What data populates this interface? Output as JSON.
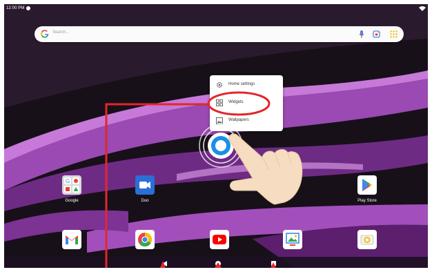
{
  "status_bar": {
    "time": "12:00 PM"
  },
  "search": {
    "placeholder": "Search..."
  },
  "context_menu": {
    "items": [
      {
        "label": "Home settings",
        "icon": "gear-icon"
      },
      {
        "label": "Widgets",
        "icon": "widgets-icon"
      },
      {
        "label": "Wallpapers",
        "icon": "wallpaper-icon"
      }
    ]
  },
  "apps": {
    "row1": [
      {
        "label": "Google",
        "icon": "google-folder-icon"
      },
      {
        "label": "Duo",
        "icon": "duo-icon"
      },
      {
        "label": "Play Store",
        "icon": "play-store-icon"
      }
    ],
    "dock": [
      {
        "label": "",
        "icon": "gmail-icon"
      },
      {
        "label": "",
        "icon": "chrome-icon"
      },
      {
        "label": "",
        "icon": "youtube-icon"
      },
      {
        "label": "",
        "icon": "photos-icon"
      },
      {
        "label": "",
        "icon": "camera-icon"
      }
    ]
  },
  "colors": {
    "annotation_red": "#e3262b",
    "wallpaper_purple": "#8a3fa3",
    "touch_blue": "#1a8fe6",
    "hand_skin": "#f6dcc0"
  }
}
